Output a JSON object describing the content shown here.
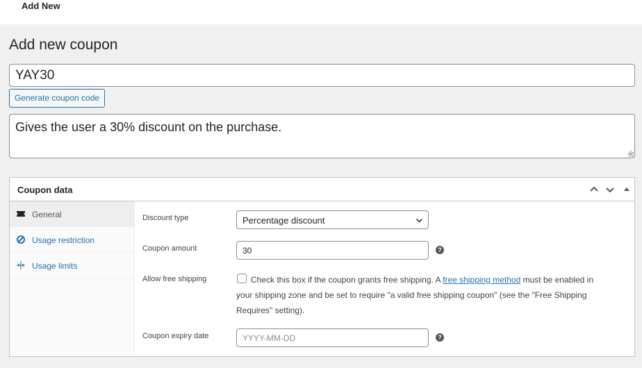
{
  "topbar": {
    "title": "Add New"
  },
  "page": {
    "title": "Add new coupon",
    "coupon_code": "YAY30",
    "generate_button": "Generate coupon code",
    "description": "Gives the user a 30% discount on the purchase."
  },
  "coupon_data": {
    "title": "Coupon data",
    "tabs": [
      {
        "label": "General",
        "icon": "ticket-icon",
        "active": true
      },
      {
        "label": "Usage restriction",
        "icon": "block-icon",
        "active": false
      },
      {
        "label": "Usage limits",
        "icon": "limits-icon",
        "active": false
      }
    ],
    "fields": {
      "discount_type_label": "Discount type",
      "discount_type_value": "Percentage discount",
      "coupon_amount_label": "Coupon amount",
      "coupon_amount_value": "30",
      "free_shipping_label": "Allow free shipping",
      "free_shipping_text_1": "Check this box if the coupon grants free shipping. A",
      "free_shipping_link": "free shipping method",
      "free_shipping_text_2": "must be enabled in your shipping zone and be set to require \"a valid free shipping coupon\" (see the \"Free Shipping Requires\" setting).",
      "free_shipping_checked": false,
      "expiry_label": "Coupon expiry date",
      "expiry_placeholder": "YYYY-MM-DD"
    }
  },
  "colors": {
    "accent": "#2271b1",
    "background": "#f0f0f1",
    "border": "#8c8f94"
  }
}
